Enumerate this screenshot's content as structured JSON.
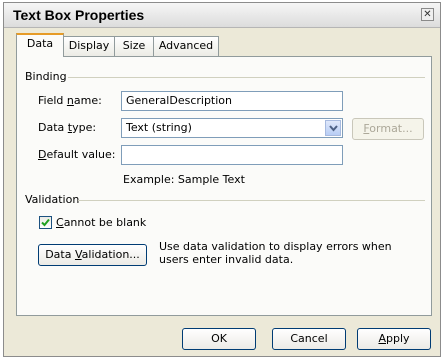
{
  "window": {
    "title": "Text Box Properties"
  },
  "tabs": [
    {
      "label": "Data",
      "active": true
    },
    {
      "label": "Display",
      "active": false
    },
    {
      "label": "Size",
      "active": false
    },
    {
      "label": "Advanced",
      "active": false
    }
  ],
  "binding": {
    "group_label": "Binding",
    "field_name_label_a": "Field ",
    "field_name_label_u": "n",
    "field_name_label_b": "ame:",
    "field_name_value": "GeneralDescription",
    "data_type_label_a": "Data ",
    "data_type_label_u": "t",
    "data_type_label_b": "ype:",
    "data_type_value": "Text (string)",
    "format_label_u": "F",
    "format_label_b": "ormat...",
    "default_value_label_u": "D",
    "default_value_label_b": "efault value:",
    "default_value_value": "",
    "example_text": "Example: Sample Text"
  },
  "validation": {
    "group_label": "Validation",
    "cannot_be_blank_u": "C",
    "cannot_be_blank_b": "annot be blank",
    "cannot_be_blank_checked": true,
    "data_validation_a": "Data ",
    "data_validation_u": "V",
    "data_validation_b": "alidation...",
    "help_line1": "Use data validation to display errors when",
    "help_line2": "users enter invalid data."
  },
  "buttons": {
    "ok": "OK",
    "cancel": "Cancel",
    "apply_u": "A",
    "apply_b": "pply"
  },
  "colors": {
    "accent": "#e69b27",
    "input_border": "#7f9db9",
    "dialog_bg": "#ece9d8"
  }
}
